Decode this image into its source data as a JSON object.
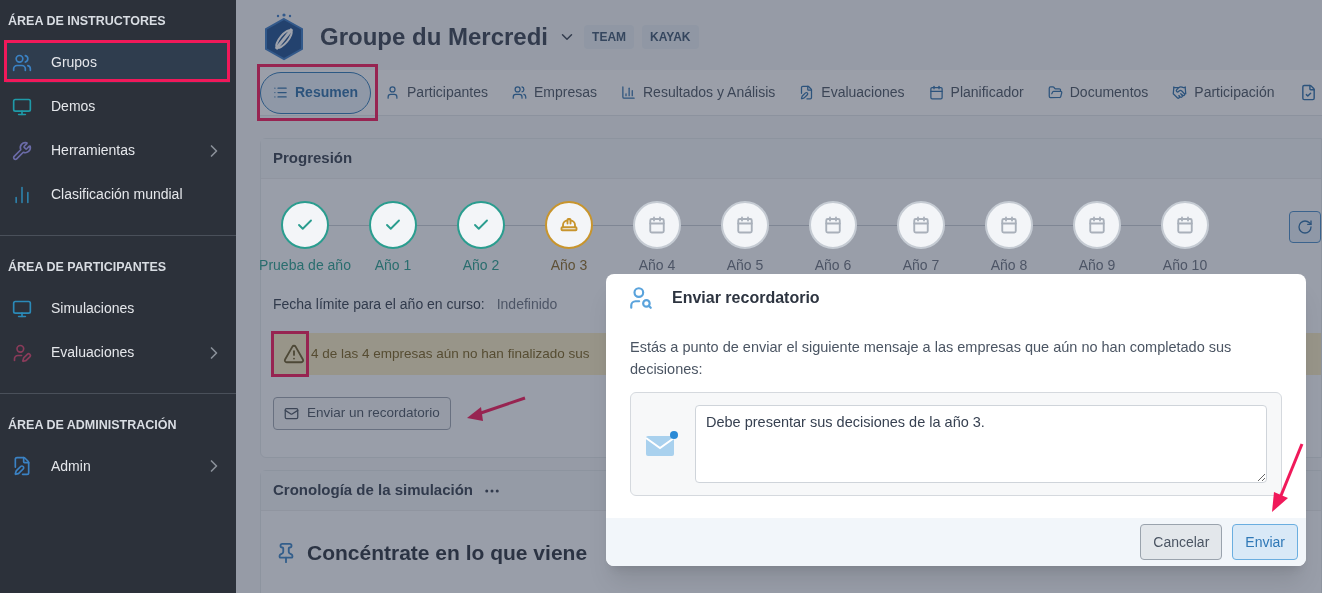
{
  "sidebar": {
    "sections": [
      {
        "title": "ÁREA DE INSTRUCTORES",
        "items": [
          {
            "label": "Grupos",
            "selected": true,
            "submenu": false
          },
          {
            "label": "Demos",
            "selected": false,
            "submenu": false
          },
          {
            "label": "Herramientas",
            "selected": false,
            "submenu": true
          },
          {
            "label": "Clasificación mundial",
            "selected": false,
            "submenu": false
          }
        ]
      },
      {
        "title": "ÁREA DE PARTICIPANTES",
        "items": [
          {
            "label": "Simulaciones",
            "selected": false,
            "submenu": false
          },
          {
            "label": "Evaluaciones",
            "selected": false,
            "submenu": true
          }
        ]
      },
      {
        "title": "ÁREA DE ADMINISTRACIÓN",
        "items": [
          {
            "label": "Admin",
            "selected": false,
            "submenu": true
          }
        ]
      }
    ]
  },
  "header": {
    "title": "Groupe du Mercredi",
    "tags": [
      "TEAM",
      "KAYAK"
    ]
  },
  "tabs": [
    {
      "label": "Resumen",
      "selected": true
    },
    {
      "label": "Participantes",
      "selected": false
    },
    {
      "label": "Empresas",
      "selected": false
    },
    {
      "label": "Resultados y Análisis",
      "selected": false
    },
    {
      "label": "Evaluaciones",
      "selected": false
    },
    {
      "label": "Planificador",
      "selected": false
    },
    {
      "label": "Documentos",
      "selected": false
    },
    {
      "label": "Participación",
      "selected": false
    }
  ],
  "progression": {
    "title": "Progresión",
    "steps": [
      {
        "label": "Prueba de año",
        "kind": "done"
      },
      {
        "label": "Año 1",
        "kind": "done"
      },
      {
        "label": "Año 2",
        "kind": "done"
      },
      {
        "label": "Año 3",
        "kind": "current"
      },
      {
        "label": "Año 4",
        "kind": "pending"
      },
      {
        "label": "Año 5",
        "kind": "pending"
      },
      {
        "label": "Año 6",
        "kind": "pending"
      },
      {
        "label": "Año 7",
        "kind": "pending"
      },
      {
        "label": "Año 8",
        "kind": "pending"
      },
      {
        "label": "Año 9",
        "kind": "pending"
      },
      {
        "label": "Año 10",
        "kind": "pending"
      }
    ],
    "deadline_label": "Fecha límite para el año en curso:",
    "deadline_value": "Indefinido",
    "warning": "4 de las 4 empresas aún no han finalizado sus",
    "reminder_button": "Enviar un recordatorio"
  },
  "timeline": {
    "title": "Cronología de la simulación",
    "heading": "Concéntrate en lo que viene"
  },
  "modal": {
    "title": "Enviar recordatorio",
    "text": "Estás a punto de enviar el siguiente mensaje a las empresas que aún no han completado sus decisiones:",
    "message": "Debe presentar sus decisiones de la año 3.",
    "buttons": [
      {
        "label": "Cancelar",
        "kind": "secondary"
      },
      {
        "label": "Enviar",
        "kind": "primary"
      }
    ]
  }
}
